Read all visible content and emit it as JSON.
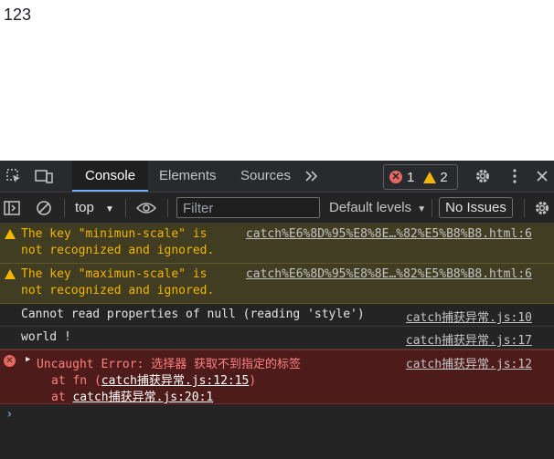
{
  "page": {
    "content": "123"
  },
  "tabs": [
    {
      "label": "Console",
      "active": true
    },
    {
      "label": "Elements",
      "active": false
    },
    {
      "label": "Sources",
      "active": false
    }
  ],
  "counts": {
    "errors": "1",
    "warnings": "2"
  },
  "toolbar": {
    "context": "top",
    "filter_placeholder": "Filter",
    "levels": "Default levels",
    "issues": "No Issues"
  },
  "messages": [
    {
      "type": "warning",
      "lines": [
        "The key \"minimun-scale\" is",
        "not recognized and ignored."
      ],
      "source": "catch%E6%8D%95%E8%8E…%82%E5%B8%B8.html:6"
    },
    {
      "type": "warning",
      "lines": [
        "The key \"maximun-scale\" is",
        "not recognized and ignored."
      ],
      "source": "catch%E6%8D%95%E8%8E…%82%E5%B8%B8.html:6"
    },
    {
      "type": "log",
      "text": "Cannot read properties of null (reading 'style')",
      "source": "catch捕获异常.js:10"
    },
    {
      "type": "log",
      "text": "world !",
      "source": "catch捕获异常.js:17"
    },
    {
      "type": "error",
      "text": "Uncaught Error: 选择器 获取不到指定的标签",
      "source": "catch捕获异常.js:12",
      "stack": [
        {
          "prefix": "at fn (",
          "link": "catch捕获异常.js:12:15",
          "suffix": ")"
        },
        {
          "prefix": "at ",
          "link": "catch捕获异常.js:20:1",
          "suffix": ""
        }
      ]
    }
  ],
  "colors": {
    "warning": "#f2b600",
    "error": "#e46962",
    "accent": "#7cacf8"
  }
}
